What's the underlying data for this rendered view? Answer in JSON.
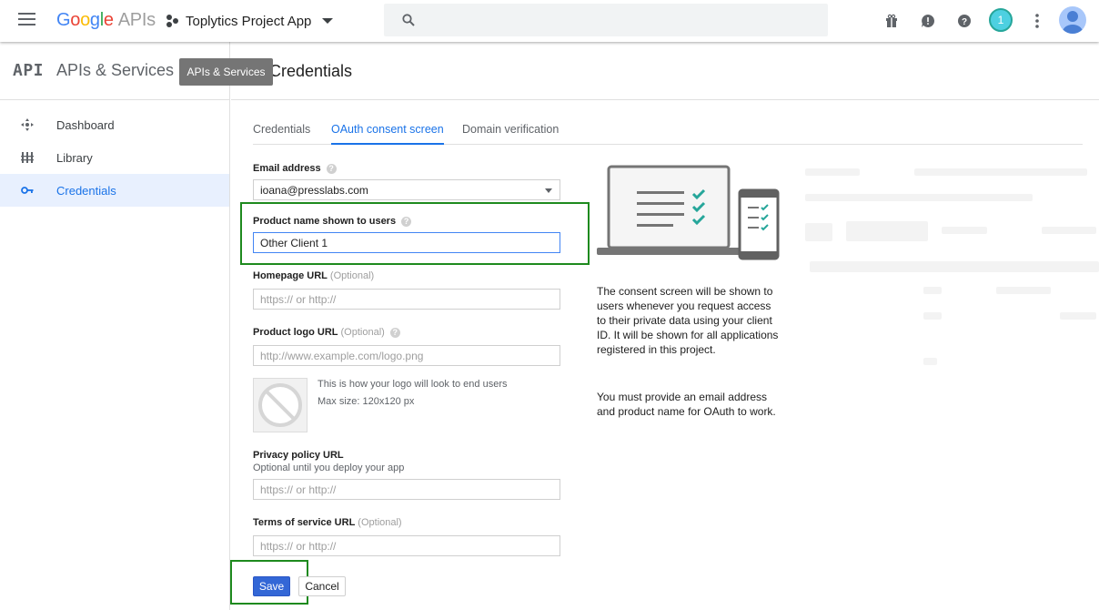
{
  "topbar": {
    "logo_google": "Google",
    "logo_apis": "APIs",
    "project_name": "Toplytics Project App",
    "notification_count": "1"
  },
  "sidebar": {
    "title": "APIs & Services",
    "api_logo": "API",
    "items": [
      {
        "label": "Dashboard",
        "icon": "dashboard-icon"
      },
      {
        "label": "Library",
        "icon": "library-icon"
      },
      {
        "label": "Credentials",
        "icon": "key-icon"
      }
    ]
  },
  "tooltip": "APIs & Services",
  "page_title": "Credentials",
  "tabs": [
    "Credentials",
    "OAuth consent screen",
    "Domain verification"
  ],
  "form": {
    "email": {
      "label": "Email address",
      "value": "ioana@presslabs.com"
    },
    "product_name": {
      "label": "Product name shown to users",
      "value": "Other Client 1"
    },
    "homepage": {
      "label": "Homepage URL",
      "optional": "(Optional)",
      "placeholder": "https:// or http://"
    },
    "logo_url": {
      "label": "Product logo URL",
      "optional": "(Optional)",
      "placeholder": "http://www.example.com/logo.png"
    },
    "logo_hint_1": "This is how your logo will look to end users",
    "logo_hint_2": "Max size: 120x120 px",
    "privacy": {
      "label": "Privacy policy URL",
      "sublabel": "Optional until you deploy your app",
      "placeholder": "https:// or http://"
    },
    "terms": {
      "label": "Terms of service URL",
      "optional": "(Optional)",
      "placeholder": "https:// or http://"
    },
    "save_label": "Save",
    "cancel_label": "Cancel"
  },
  "info": {
    "paragraph_1": "The consent screen will be shown to users whenever you request access to their private data using your client ID. It will be shown for all applications registered in this project.",
    "paragraph_2": "You must provide an email address and product name for OAuth to work."
  },
  "colors": {
    "accent": "#1a73e8",
    "highlight": "#1e8a1e",
    "save_button": "#3367d6"
  }
}
